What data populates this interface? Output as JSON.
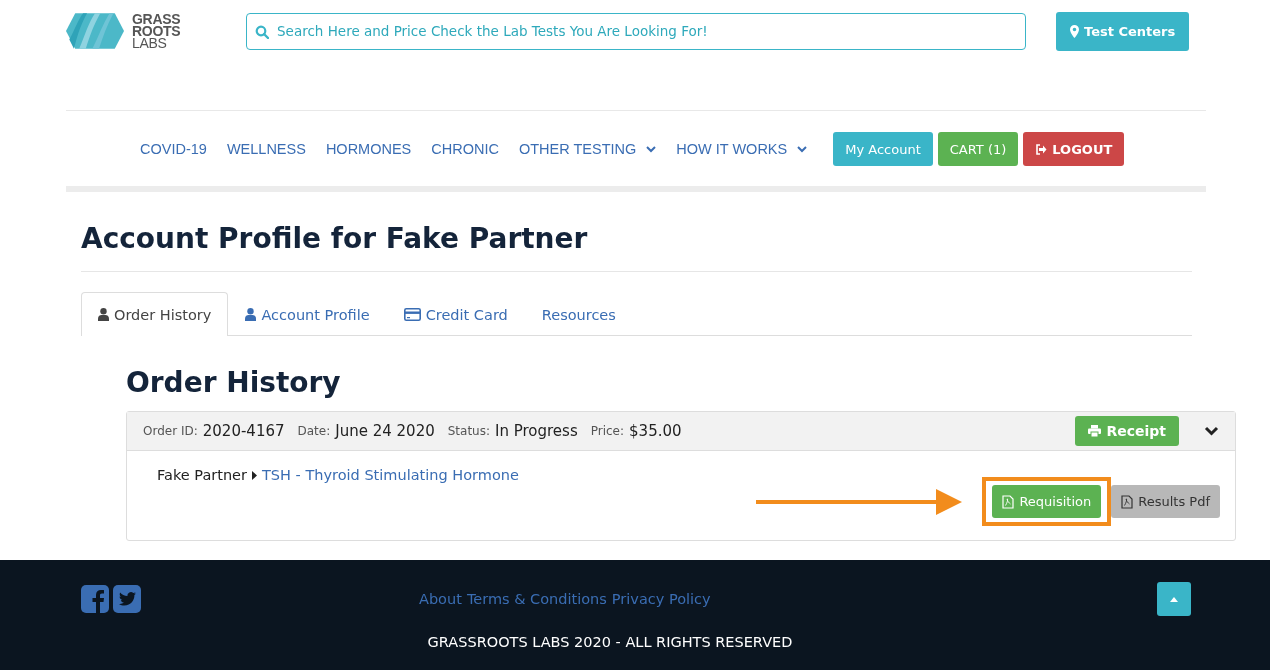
{
  "logo": {
    "lines": [
      "GRASS",
      "ROOTS",
      "LABS"
    ]
  },
  "search": {
    "placeholder": "Search Here and Price Check the Lab Tests You Are Looking For!"
  },
  "test_centers_button": "Test Centers",
  "nav": {
    "items": [
      {
        "label": "COVID-19",
        "has_dropdown": false
      },
      {
        "label": "WELLNESS",
        "has_dropdown": false
      },
      {
        "label": "HORMONES",
        "has_dropdown": false
      },
      {
        "label": "CHRONIC",
        "has_dropdown": false
      },
      {
        "label": "OTHER TESTING",
        "has_dropdown": true
      },
      {
        "label": "HOW IT WORKS",
        "has_dropdown": true
      }
    ],
    "buttons": [
      {
        "label": "My Account",
        "kind": "info"
      },
      {
        "label": "CART (1)",
        "kind": "success"
      },
      {
        "label": "LOGOUT",
        "kind": "danger"
      }
    ]
  },
  "page_title": "Account Profile for Fake Partner",
  "tabs": [
    {
      "label": "Order History",
      "selected": true,
      "kind": "user"
    },
    {
      "label": "Account Profile",
      "selected": false,
      "kind": "user"
    },
    {
      "label": "Credit Card",
      "selected": false,
      "kind": "card"
    },
    {
      "label": "Resources",
      "selected": false,
      "kind": "plain"
    }
  ],
  "section_title": "Order History",
  "orders": [
    {
      "fields": [
        {
          "label": "Order ID:",
          "value": "2020-4167"
        },
        {
          "label": "Date:",
          "value": "June 24 2020"
        },
        {
          "label": "Status:",
          "value": "In Progress"
        },
        {
          "label": "Price:",
          "value": "$35.00"
        }
      ],
      "receipt_button": "Receipt",
      "expanded": true,
      "items": [
        {
          "patient": "Fake Partner",
          "test": "TSH - Thyroid Stimulating Hormone",
          "actions": [
            {
              "label": "Requisition",
              "kind": "success",
              "highlighted": true
            },
            {
              "label": "Results Pdf",
              "kind": "muted",
              "highlighted": false
            }
          ]
        }
      ]
    }
  ],
  "footer": {
    "links": [
      "About",
      "Terms & Conditions",
      "Privacy Policy"
    ],
    "copyright": "GRASSROOTS LABS 2020 - ALL RIGHTS RESERVED"
  }
}
